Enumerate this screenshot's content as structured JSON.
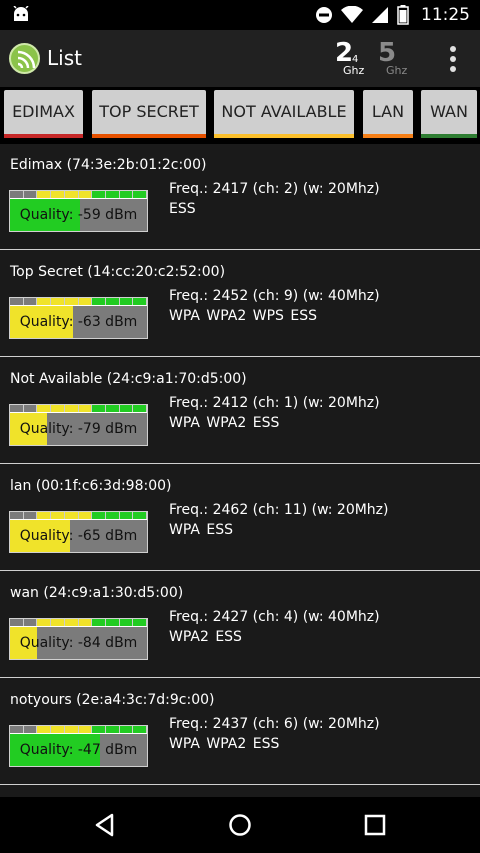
{
  "status": {
    "time": "11:25",
    "icons": [
      "android-icon",
      "dnd-icon",
      "wifi-icon",
      "signal-icon",
      "battery-icon"
    ]
  },
  "appbar": {
    "title": "List",
    "band_24": {
      "big": "2",
      "sub": "4",
      "unit": "Ghz"
    },
    "band_5": {
      "big": "5",
      "unit": "Ghz"
    }
  },
  "chips": [
    {
      "label": "EDIMAX",
      "color": "#c62828"
    },
    {
      "label": "TOP SECRET",
      "color": "#e65100"
    },
    {
      "label": "NOT AVAILABLE",
      "color": "#fbc02d"
    },
    {
      "label": "LAN",
      "color": "#f57f17"
    },
    {
      "label": "WAN",
      "color": "#2e7d32"
    }
  ],
  "networks": [
    {
      "name": "Edimax (74:3e:2b:01:2c:00)",
      "quality": "Quality: -59 dBm",
      "level": 0.51,
      "color": "#22cc22",
      "freq": "Freq.: 2417 (ch: 2) (w: 20Mhz)",
      "security": "ESS"
    },
    {
      "name": "Top Secret (14:cc:20:c2:52:00)",
      "quality": "Quality: -63 dBm",
      "level": 0.46,
      "color": "#f0e32a",
      "freq": "Freq.: 2452 (ch: 9) (w: 40Mhz)",
      "security": "WPA WPA2 WPS ESS"
    },
    {
      "name": "Not Available (24:c9:a1:70:d5:00)",
      "quality": "Quality: -79 dBm",
      "level": 0.27,
      "color": "#f0e32a",
      "freq": "Freq.: 2412 (ch: 1) (w: 20Mhz)",
      "security": "WPA WPA2 ESS"
    },
    {
      "name": "lan (00:1f:c6:3d:98:00)",
      "quality": "Quality: -65 dBm",
      "level": 0.44,
      "color": "#f0e32a",
      "freq": "Freq.: 2462 (ch: 11) (w: 20Mhz)",
      "security": "WPA ESS"
    },
    {
      "name": "wan (24:c9:a1:30:d5:00)",
      "quality": "Quality: -84 dBm",
      "level": 0.2,
      "color": "#f0e32a",
      "freq": "Freq.: 2427 (ch: 4) (w: 40Mhz)",
      "security": "WPA2 ESS"
    },
    {
      "name": "notyours (2e:a4:3c:7d:9c:00)",
      "quality": "Quality: -47 dBm",
      "level": 0.66,
      "color": "#22cc22",
      "freq": "Freq.: 2437 (ch: 6) (w: 20Mhz)",
      "security": "WPA WPA2 ESS"
    }
  ],
  "navbar": {
    "icons": [
      "back-icon",
      "home-icon",
      "recents-icon"
    ]
  }
}
